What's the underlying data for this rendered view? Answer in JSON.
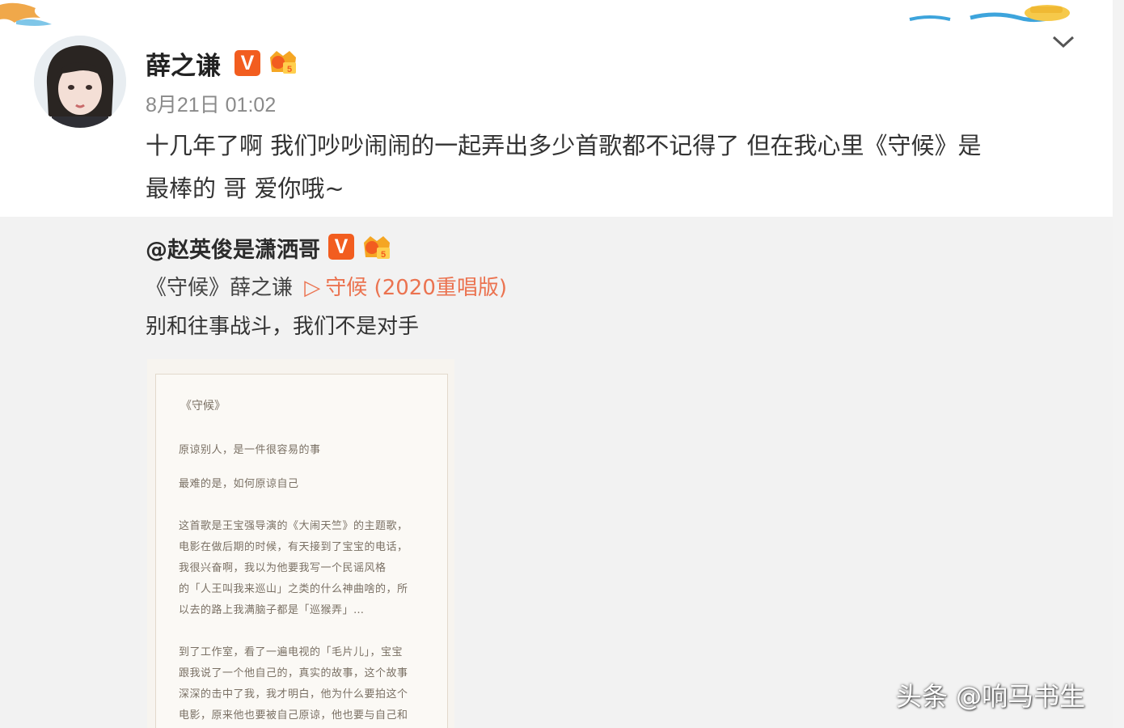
{
  "post": {
    "author": "薛之谦",
    "verified_badge": "V",
    "time": "8月21日 01:02",
    "text_line1": "十几年了啊 我们吵吵闹闹的一起弄出多少首歌都不记得了 但在我心里《守候》是",
    "text_line2": "最棒的  哥 爱你哦~",
    "more_icon": "chevron-down-icon"
  },
  "repost": {
    "author": "@赵英俊是潇洒哥",
    "verified_badge": "V",
    "song_prefix": "《守候》薛之谦",
    "song_link_icon": "▷",
    "song_link": "守候 (2020重唱版)",
    "text": "别和往事战斗，我们不是对手",
    "lyric_image": {
      "title": "《守候》",
      "lines": [
        "原谅别人，是一件很容易的事",
        "最难的是，如何原谅自己",
        "这首歌是王宝强导演的《大闹天竺》的主题歌，",
        "电影在做后期的时候，有天接到了宝宝的电话，",
        "我很兴奋啊，我以为他要我写一个民谣风格",
        "的「人王叫我来巡山」之类的什么神曲啥的，所",
        "以去的路上我满脑子都是「巡猴弄」…",
        "到了工作室，看了一遍电视的「毛片儿」，宝宝",
        "跟我说了一个他自己的，真实的故事，这个故事",
        "深深的击中了我，我才明白，他为什么要拍这个",
        "电影，原来他也要被自己原谅，他也要与自己和"
      ]
    }
  },
  "watermark": "头条 @响马书生",
  "colors": {
    "accent_orange": "#eb7350",
    "badge_orange": "#f25d1f",
    "repost_bg": "#f2f2f2"
  }
}
